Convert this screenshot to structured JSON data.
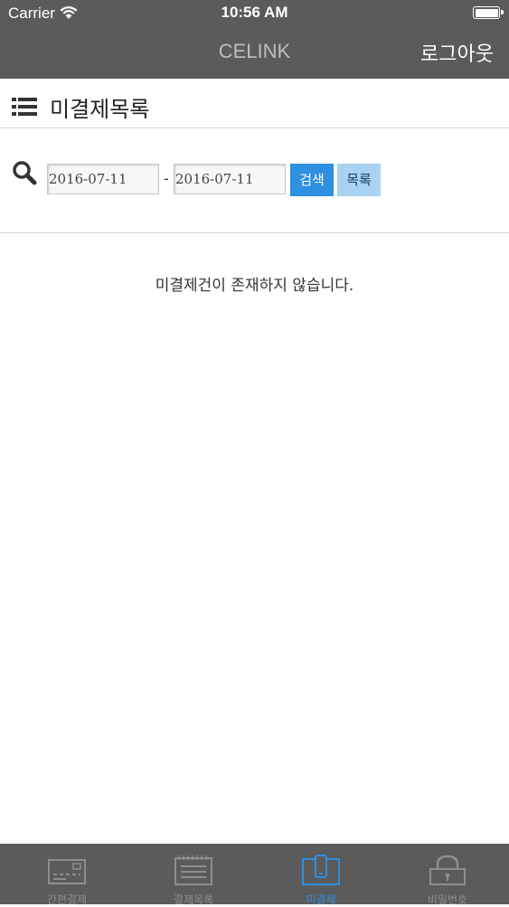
{
  "status_bar": {
    "carrier": "Carrier",
    "time": "10:56 AM"
  },
  "nav": {
    "title": "CELINK",
    "logout_label": "로그아웃"
  },
  "page": {
    "title": "미결제목록"
  },
  "search": {
    "date_from": "2016-07-11",
    "separator": "-",
    "date_to": "2016-07-11",
    "search_label": "검색",
    "list_label": "목록"
  },
  "empty_message": "미결제건이 존재하지 않습니다.",
  "tabs": [
    {
      "label": "간편결제",
      "icon": "card-terminal-icon",
      "active": false
    },
    {
      "label": "결제목록",
      "icon": "receipt-list-icon",
      "active": false
    },
    {
      "label": "미결제",
      "icon": "phone-pending-icon",
      "active": true
    },
    {
      "label": "비밀번호",
      "icon": "lock-icon",
      "active": false
    }
  ],
  "colors": {
    "bar_bg": "#5b5b5b",
    "accent": "#2f8fe0",
    "light_button": "#a9d3f3"
  }
}
